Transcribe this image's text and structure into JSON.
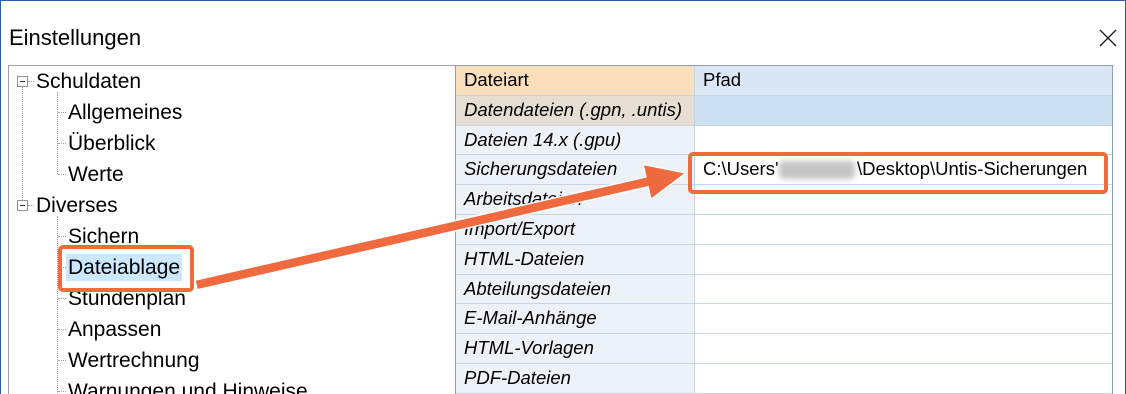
{
  "window": {
    "title": "Einstellungen"
  },
  "icons": {
    "close": "close-icon",
    "collapse": "collapse-icon",
    "arrow": "arrow-icon"
  },
  "colors": {
    "window_border": "#2b5fa6",
    "selection": "#cce8ff",
    "annotation": "#ef6a3f",
    "header_type": "#f9dfbc",
    "header_path": "#dce7f5",
    "selected_row_type": "#e6ded3",
    "selected_row_path": "#cce0f4",
    "key_column": "#edf2f9"
  },
  "tree": {
    "groups": [
      {
        "label": "Schuldaten",
        "expanded": true,
        "children": [
          {
            "label": "Allgemeines"
          },
          {
            "label": "Überblick"
          },
          {
            "label": "Werte"
          }
        ]
      },
      {
        "label": "Diverses",
        "expanded": true,
        "children": [
          {
            "label": "Sichern"
          },
          {
            "label": "Dateiablage",
            "selected": true
          },
          {
            "label": "Stundenplan"
          },
          {
            "label": "Anpassen"
          },
          {
            "label": "Wertrechnung"
          },
          {
            "label": "Warnungen und Hinweise"
          }
        ]
      }
    ]
  },
  "grid": {
    "columns": {
      "type": "Dateiart",
      "path": "Pfad"
    },
    "rows": [
      {
        "type": "Datendateien (.gpn, .untis)",
        "path": "",
        "selected": true
      },
      {
        "type": "Dateien 14.x (.gpu)",
        "path": ""
      },
      {
        "type": "Sicherungsdateien",
        "path_prefix": "C:\\Users'",
        "path_suffix": "\\Desktop\\Untis-Sicherungen"
      },
      {
        "type": "Arbeitsdateien",
        "path": ""
      },
      {
        "type": "Import/Export",
        "path": ""
      },
      {
        "type": "HTML-Dateien",
        "path": ""
      },
      {
        "type": "Abteilungsdateien",
        "path": ""
      },
      {
        "type": "E-Mail-Anhänge",
        "path": ""
      },
      {
        "type": "HTML-Vorlagen",
        "path": ""
      },
      {
        "type": "PDF-Dateien",
        "path": ""
      }
    ]
  }
}
